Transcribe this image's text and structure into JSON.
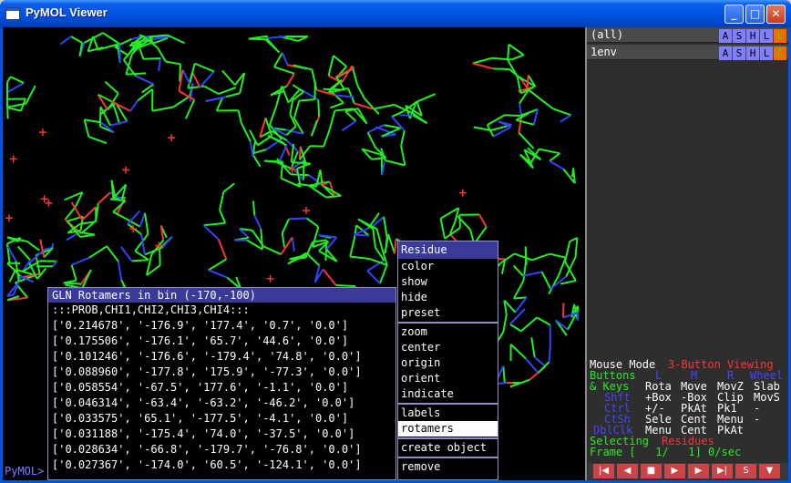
{
  "window": {
    "title": "PyMOL Viewer"
  },
  "window_buttons": {
    "minimize": "_",
    "maximize": "□",
    "close": "✕"
  },
  "objects": [
    {
      "name": "(all)",
      "buttons": [
        "A",
        "S",
        "H",
        "L",
        "C"
      ]
    },
    {
      "name": "1env",
      "buttons": [
        "A",
        "S",
        "H",
        "L",
        "C"
      ]
    }
  ],
  "mouse": {
    "mode_label": "Mouse Mode",
    "mode_value": "3-Button Viewing",
    "buttons_label": "Buttons",
    "col_l": "L",
    "col_m": "M",
    "col_r": "R",
    "col_wheel": "Wheel",
    "rows": [
      {
        "key": "& Keys",
        "l": "Rota",
        "m": "Move",
        "r": "MovZ",
        "w": "Slab"
      },
      {
        "key": "Shft",
        "l": "+Box",
        "m": "-Box",
        "r": "Clip",
        "w": "MovS"
      },
      {
        "key": "Ctrl",
        "l": "+/-",
        "m": "PkAt",
        "r": "Pk1",
        "w": "-"
      },
      {
        "key": "CtSh",
        "l": "Sele",
        "m": "Cent",
        "r": "Menu",
        "w": "-"
      },
      {
        "key": "DblClk",
        "l": "Menu",
        "m": "Cent",
        "r": "PkAt",
        "w": ""
      }
    ],
    "selecting_label": "Selecting",
    "selecting_value": "Residues",
    "frame_text": "Frame [   1/   1] 0/sec"
  },
  "player_buttons": [
    "|◀",
    "◀",
    "■",
    "▶",
    "▶",
    "▶|",
    "S",
    "▼"
  ],
  "command_prompt": "PyMOL>",
  "rotamer_panel": {
    "title": "GLN Rotamers in bin (-170,-100)",
    "header": ":::PROB,CHI1,CHI2,CHI3,CHI4:::",
    "rows": [
      "['0.214678', '-176.9', '177.4', '0.7', '0.0']",
      "['0.175506', '-176.1', '65.7', '44.6', '0.0']",
      "['0.101246', '-176.6', '-179.4', '74.8', '0.0']",
      "['0.088960', '-177.8', '175.9', '-77.3', '0.0']",
      "['0.058554', '-67.5', '177.6', '-1.1', '0.0']",
      "['0.046314', '-63.4', '-63.2', '-46.2', '0.0']",
      "['0.033575', '65.1', '-177.5', '-4.1', '0.0']",
      "['0.031188', '-175.4', '74.0', '-37.5', '0.0']",
      "['0.028634', '-66.8', '-179.7', '-76.8', '0.0']",
      "['0.027367', '-174.0', '60.5', '-124.1', '0.0']"
    ]
  },
  "context_menu": {
    "title": "Residue",
    "group1": [
      "color",
      "show",
      "hide",
      "preset"
    ],
    "group2": [
      "zoom",
      "center",
      "origin",
      "orient",
      "indicate"
    ],
    "group3": [
      "labels",
      "rotamers"
    ],
    "group4": [
      "create object"
    ],
    "group5": [
      "remove"
    ],
    "selected": "rotamers"
  },
  "colors": {
    "bond_carbon": "#22ee22",
    "bond_nitrogen": "#3344ff",
    "bond_oxygen": "#ff3333",
    "menu_header": "#3a3a9a",
    "titlebar": "#0054e3"
  }
}
